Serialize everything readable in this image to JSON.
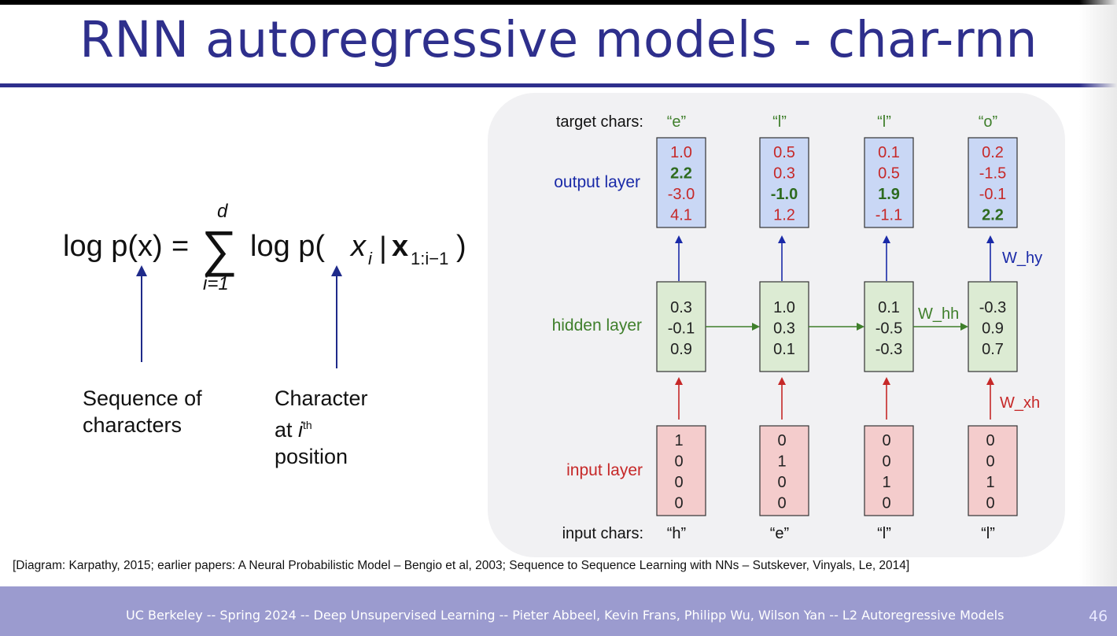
{
  "slide": {
    "title": "RNN autoregressive models - char-rnn",
    "page_number": "46",
    "footer": "UC Berkeley -- Spring 2024 -- Deep Unsupervised Learning -- Pieter Abbeel, Kevin Frans, Philipp Wu, Wilson Yan -- L2 Autoregressive Models",
    "citation": "[Diagram: Karpathy, 2015; earlier papers: A Neural Probabilistic Model – Bengio et al, 2003; Sequence to Sequence Learning with NNs – Sutskever, Vinyals, Le, 2014]"
  },
  "formula": {
    "lhs": "log p(x)",
    "equals": "=",
    "sum_upper": "d",
    "sum_lower": "i=1",
    "rhs_log": "log p(",
    "rhs_var": "x",
    "rhs_var_sub": "i",
    "rhs_given": "|",
    "rhs_cond": "x",
    "rhs_cond_sub": "1:i−1",
    "rhs_close": ")"
  },
  "annotations": {
    "left": [
      "Sequence of",
      "characters"
    ],
    "right_line1": "Character",
    "right_at": "at ",
    "right_i": "i",
    "right_th": "th",
    "right_line3": "position"
  },
  "diagram": {
    "row_labels": {
      "target": "target chars:",
      "output": "output layer",
      "hidden": "hidden layer",
      "input": "input layer",
      "input_chars": "input chars:"
    },
    "weights": {
      "hy": "W_hy",
      "hh": "W_hh",
      "xh": "W_xh"
    },
    "target_chars": [
      "“e”",
      "“l”",
      "“l”",
      "“o”"
    ],
    "input_chars": [
      "“h”",
      "“e”",
      "“l”",
      "“l”"
    ],
    "output": [
      [
        "1.0",
        "2.2",
        "-3.0",
        "4.1"
      ],
      [
        "0.5",
        "0.3",
        "-1.0",
        "1.2"
      ],
      [
        "0.1",
        "0.5",
        "1.9",
        "-1.1"
      ],
      [
        "0.2",
        "-1.5",
        "-0.1",
        "2.2"
      ]
    ],
    "output_highlight": [
      1,
      2,
      2,
      3
    ],
    "hidden": [
      [
        "0.3",
        "-0.1",
        "0.9"
      ],
      [
        "1.0",
        "0.3",
        "0.1"
      ],
      [
        "0.1",
        "-0.5",
        "-0.3"
      ],
      [
        "-0.3",
        "0.9",
        "0.7"
      ]
    ],
    "input": [
      [
        "1",
        "0",
        "0",
        "0"
      ],
      [
        "0",
        "1",
        "0",
        "0"
      ],
      [
        "0",
        "0",
        "1",
        "0"
      ],
      [
        "0",
        "0",
        "1",
        "0"
      ]
    ],
    "colors": {
      "output_fill": "#c9d7f5",
      "hidden_fill": "#dcebd3",
      "input_fill": "#f4cccc",
      "red": "#c62828",
      "green": "#3f7f2b",
      "blue": "#1a2aa8",
      "highlight": "#2e6b1f"
    }
  }
}
